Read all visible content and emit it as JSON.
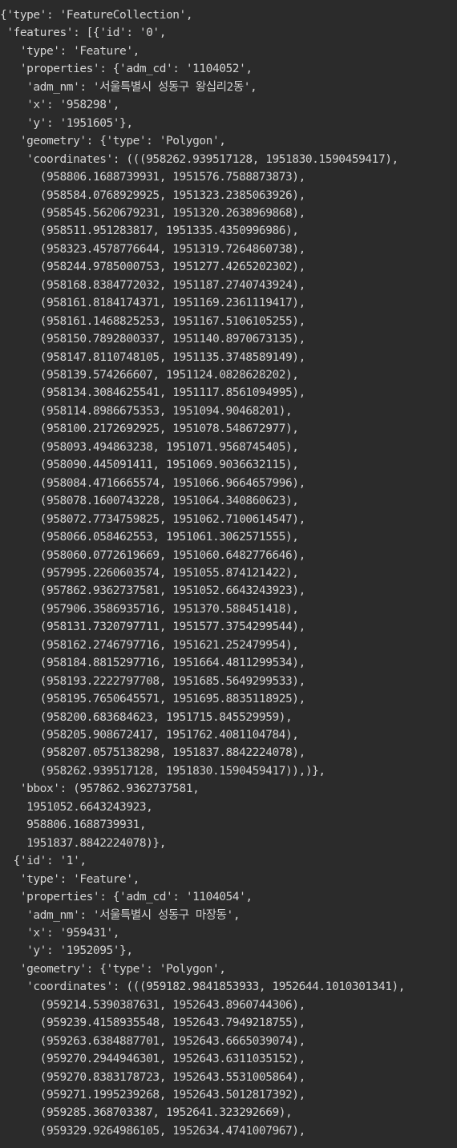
{
  "output_lines": [
    "{'type': 'FeatureCollection',",
    " 'features': [{'id': '0',",
    "   'type': 'Feature',",
    "   'properties': {'adm_cd': '1104052',",
    "    'adm_nm': '서울특별시 성동구 왕십리2동',",
    "    'x': '958298',",
    "    'y': '1951605'},",
    "   'geometry': {'type': 'Polygon',",
    "    'coordinates': (((958262.939517128, 1951830.1590459417),",
    "      (958806.1688739931, 1951576.7588873873),",
    "      (958584.0768929925, 1951323.2385063926),",
    "      (958545.5620679231, 1951320.2638969868),",
    "      (958511.951283817, 1951335.4350996986),",
    "      (958323.4578776644, 1951319.7264860738),",
    "      (958244.9785000753, 1951277.4265202302),",
    "      (958168.8384772032, 1951187.2740743924),",
    "      (958161.8184174371, 1951169.2361119417),",
    "      (958161.1468825253, 1951167.5106105255),",
    "      (958150.7892800337, 1951140.8970673135),",
    "      (958147.8110748105, 1951135.3748589149),",
    "      (958139.574266607, 1951124.0828628202),",
    "      (958134.3084625541, 1951117.8561094995),",
    "      (958114.8986675353, 1951094.90468201),",
    "      (958100.2172692925, 1951078.548672977),",
    "      (958093.494863238, 1951071.9568745405),",
    "      (958090.445091411, 1951069.9036632115),",
    "      (958084.4716665574, 1951066.9664657996),",
    "      (958078.1600743228, 1951064.340860623),",
    "      (958072.7734759825, 1951062.7100614547),",
    "      (958066.058462553, 1951061.3062571555),",
    "      (958060.0772619669, 1951060.6482776646),",
    "      (957995.2260603574, 1951055.874121422),",
    "      (957862.9362737581, 1951052.6643243923),",
    "      (957906.3586935716, 1951370.588451418),",
    "      (958131.7320797711, 1951577.3754299544),",
    "      (958162.2746797716, 1951621.252479954),",
    "      (958184.8815297716, 1951664.4811299534),",
    "      (958193.2222797708, 1951685.5649299533),",
    "      (958195.7650645571, 1951695.8835118925),",
    "      (958200.683684623, 1951715.845529959),",
    "      (958205.908672417, 1951762.4081104784),",
    "      (958207.0575138298, 1951837.8842224078),",
    "      (958262.939517128, 1951830.1590459417)),)},",
    "   'bbox': (957862.9362737581,",
    "    1951052.6643243923,",
    "    958806.1688739931,",
    "    1951837.8842224078)},",
    "  {'id': '1',",
    "   'type': 'Feature',",
    "   'properties': {'adm_cd': '1104054',",
    "    'adm_nm': '서울특별시 성동구 마장동',",
    "    'x': '959431',",
    "    'y': '1952095'},",
    "   'geometry': {'type': 'Polygon',",
    "    'coordinates': (((959182.9841853933, 1952644.1010301341),",
    "      (959214.5390387631, 1952643.8960744306),",
    "      (959239.4158935548, 1952643.7949218755),",
    "      (959263.6384887701, 1952643.6665039074),",
    "      (959270.2944946301, 1952643.6311035152),",
    "      (959270.8383178723, 1952643.5531005864),",
    "      (959271.1995239268, 1952643.5012817392),",
    "      (959285.368703387, 1952641.323292669),",
    "      (959329.9264986105, 1952634.4741007967),"
  ]
}
